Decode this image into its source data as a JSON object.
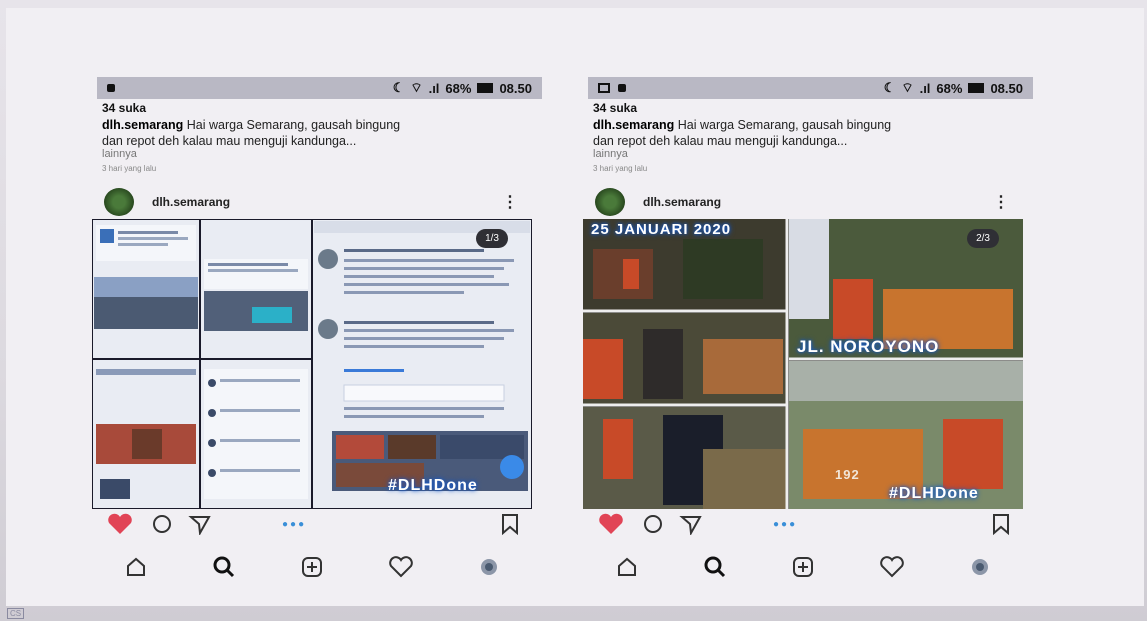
{
  "phones": [
    {
      "status": {
        "battery": "68%",
        "time": "08.50"
      },
      "likes": "34 suka",
      "caption_user": "dlh.semarang",
      "caption_line1": "Hai warga Semarang, gausah bingung",
      "caption_line2": "dan repot deh kalau mau menguji kandunga...",
      "more": "lainnya",
      "time_ago": "3 hari yang lalu",
      "username": "dlh.semarang",
      "counter": "1/3",
      "hashtag": "#DLHDone"
    },
    {
      "status": {
        "battery": "68%",
        "time": "08.50"
      },
      "likes": "34 suka",
      "caption_user": "dlh.semarang",
      "caption_line1": "Hai warga Semarang, gausah bingung",
      "caption_line2": "dan repot deh kalau mau menguji kandunga...",
      "more": "lainnya",
      "time_ago": "3 hari yang lalu",
      "username": "dlh.semarang",
      "counter": "2/3",
      "date_label": "25 JANUARI 2020",
      "street_label": "JL. NOROYONO",
      "truck_number": "192",
      "hashtag": "#DLHDone"
    }
  ],
  "colors": {
    "like": "#e14456",
    "status_bg": "#b9b8c4",
    "hashtag_glow": "#1457c7"
  },
  "icons": [
    "heart-icon",
    "comment-icon",
    "share-icon",
    "bookmark-icon",
    "home-icon",
    "search-icon",
    "add-icon",
    "activity-icon",
    "profile-icon"
  ],
  "watermark": "CS"
}
